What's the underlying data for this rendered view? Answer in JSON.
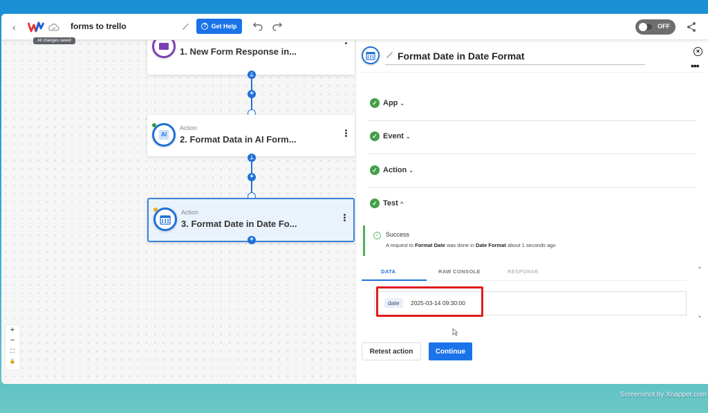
{
  "topbar": {
    "flow_name": "forms to trello",
    "save_tooltip": "All changes saved",
    "get_help_label": "Get Help",
    "toggle_label": "OFF",
    "toggle_state": "off"
  },
  "canvas": {
    "nodes": [
      {
        "type": "",
        "title": "1. New Form Response in...",
        "icon": "form-icon",
        "color": "#7b3fb5"
      },
      {
        "type": "Action",
        "title": "2. Format Data in AI Form...",
        "icon": "ai-icon",
        "status_dot": "#2e9d3a"
      },
      {
        "type": "Action",
        "title": "3. Format Date in Date Fo...",
        "icon": "calendar-icon",
        "status_dot": "#f5a623",
        "selected": true
      }
    ],
    "zoom_controls": {
      "zoom_in": "+",
      "zoom_out": "−",
      "fit": "⛶",
      "lock": "🔒"
    }
  },
  "panel": {
    "title": "Format Date in Date Format",
    "sections": [
      {
        "label": "App",
        "chevron": "⌄",
        "complete": true
      },
      {
        "label": "Event",
        "chevron": "⌄",
        "complete": true
      },
      {
        "label": "Action",
        "chevron": "⌄",
        "complete": true
      },
      {
        "label": "Test",
        "chevron": "^",
        "complete": true
      }
    ],
    "success": {
      "title": "Success",
      "msg_prefix": "A request to ",
      "msg_action": "Format Date",
      "msg_mid": " was done in ",
      "msg_app": "Date Format",
      "msg_suffix": " about 1 seconds ago"
    },
    "tabs": [
      {
        "label": "DATA",
        "active": true
      },
      {
        "label": "RAW CONSOLE",
        "active": false
      },
      {
        "label": "RESPONSE",
        "active": false
      }
    ],
    "data_rows": [
      {
        "key": "date",
        "value": "2025-03-14 09:30:00"
      }
    ],
    "retest_label": "Retest action",
    "continue_label": "Continue"
  },
  "colors": {
    "accent": "#1a73e8",
    "success": "#43a047",
    "highlight": "#e21a1a"
  },
  "watermark": "Screenshot by Xnapper.com"
}
